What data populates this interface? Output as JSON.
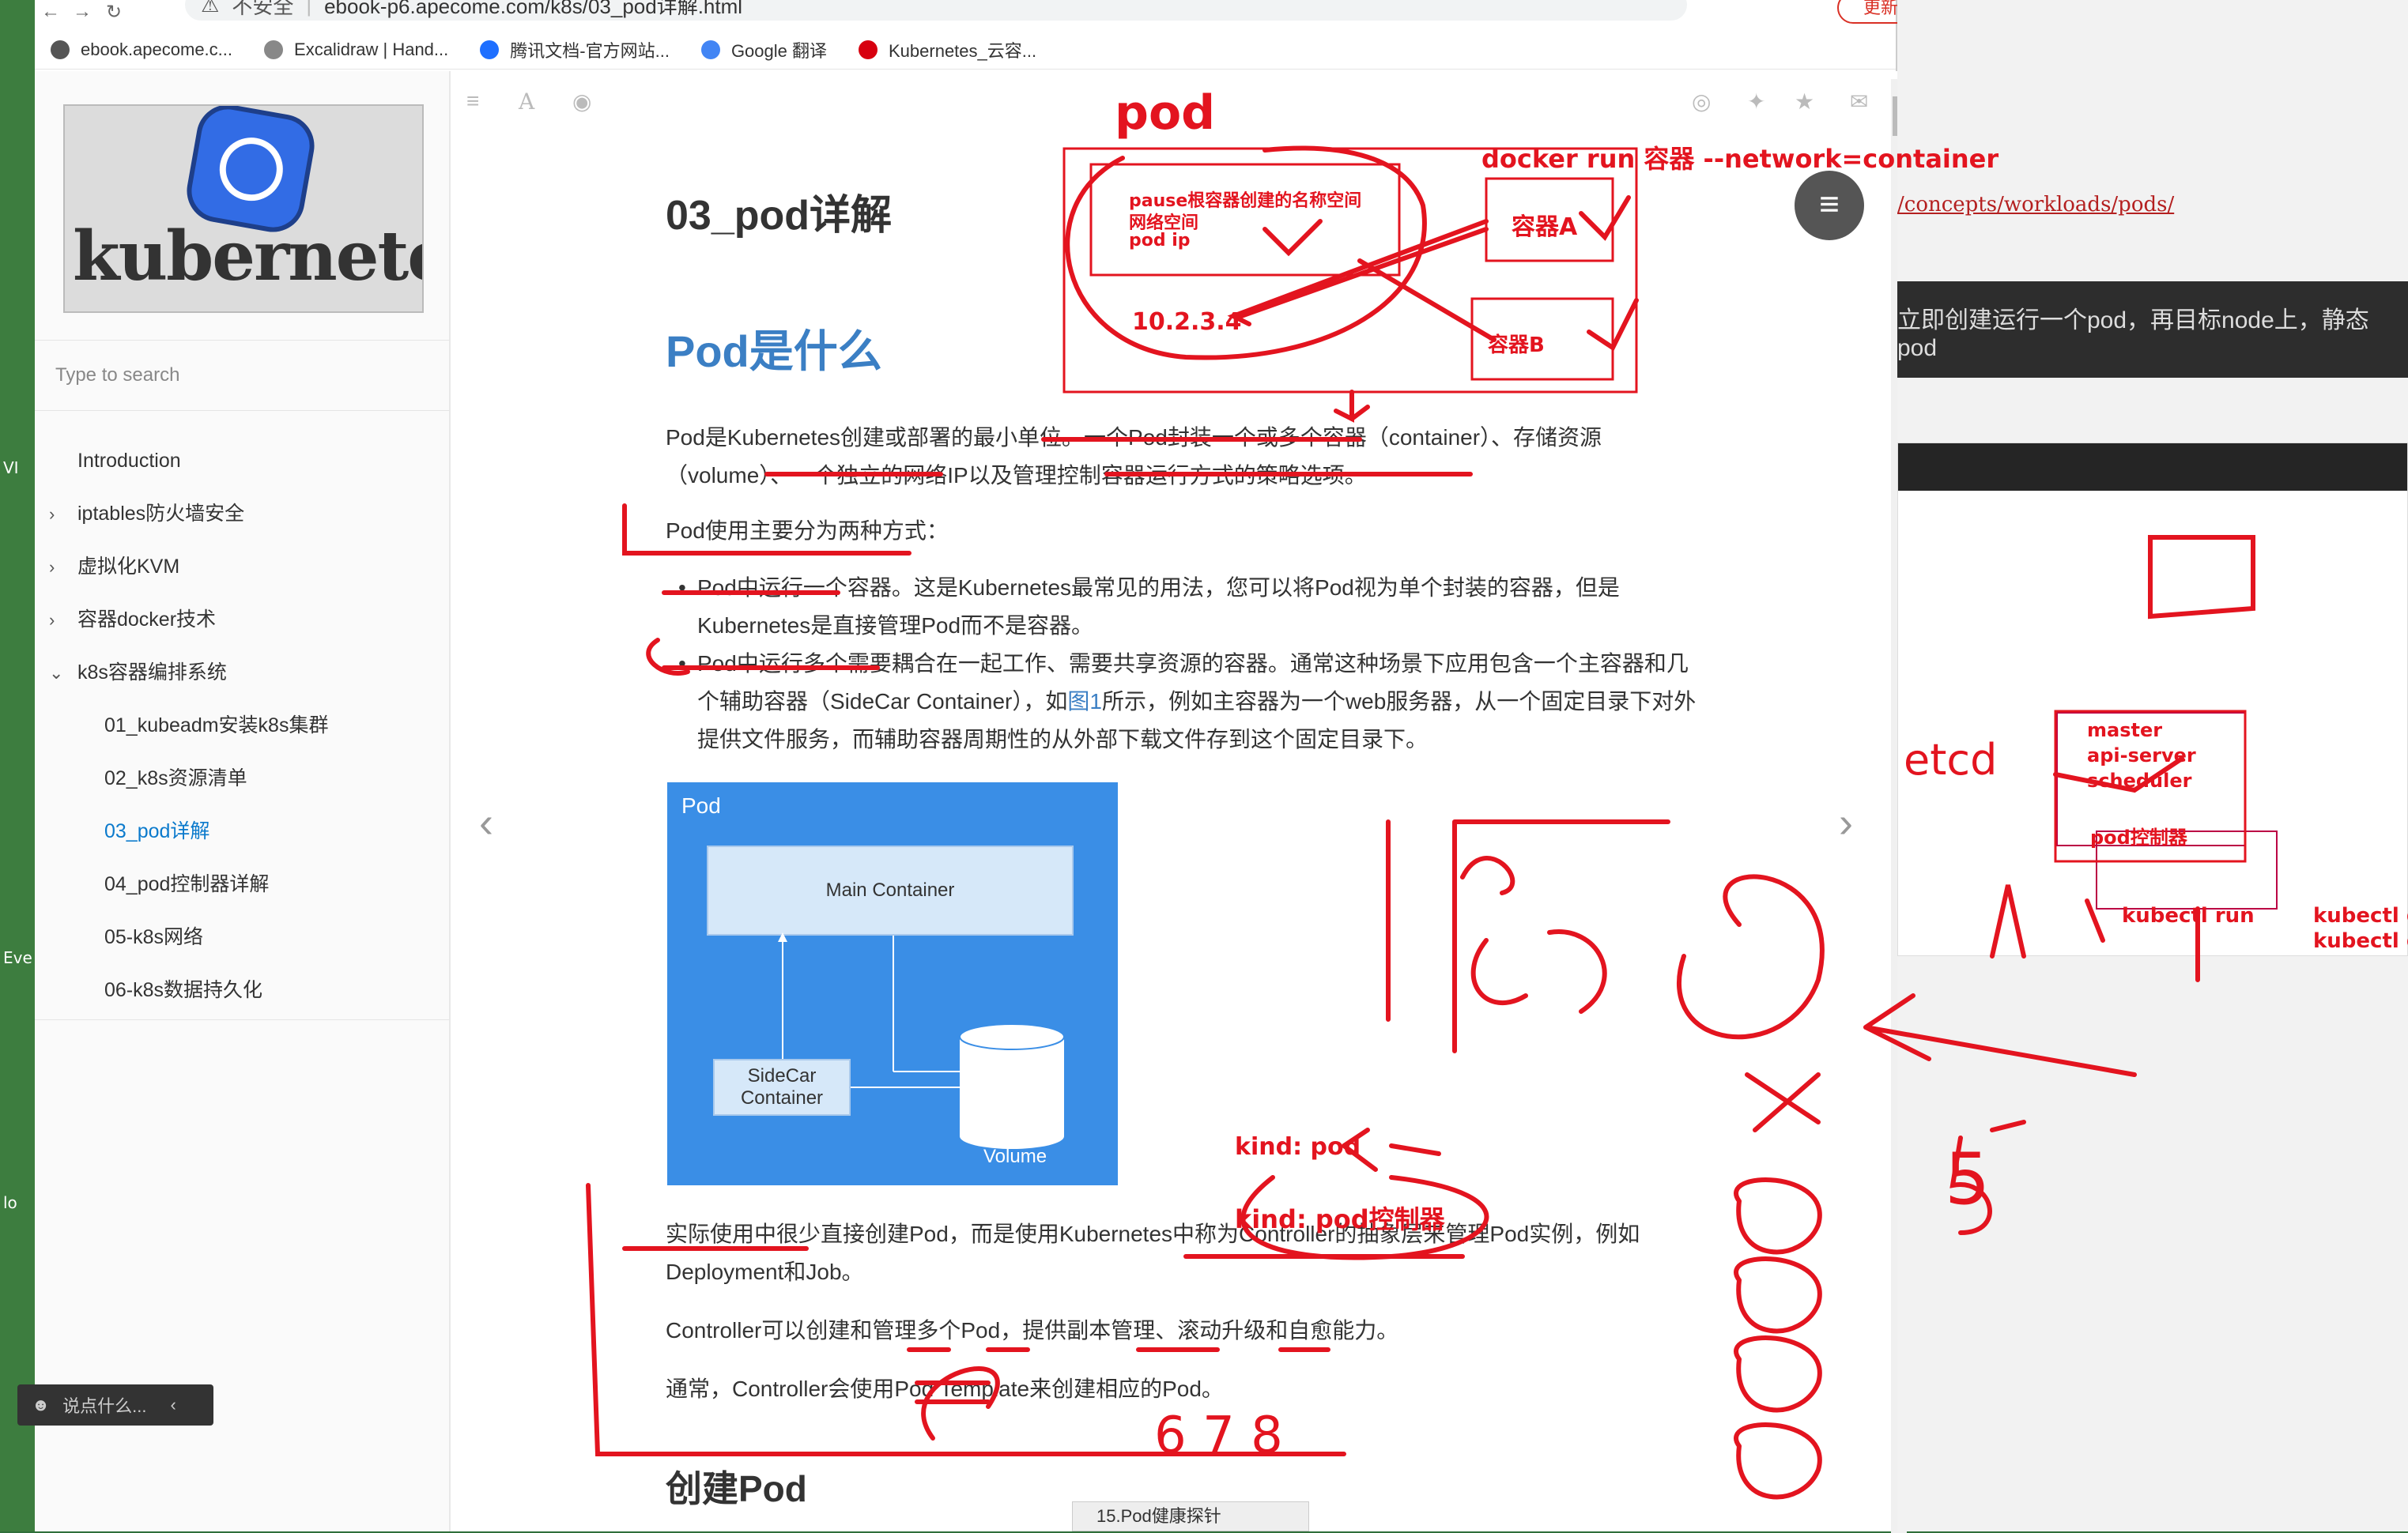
{
  "browser": {
    "insecure_label": "不安全",
    "url": "ebook-p6.apecome.com/k8s/03_pod详解.html",
    "update_label": "更新",
    "bookmarks": [
      {
        "label": "ebook.apecome.c...",
        "color": "#555"
      },
      {
        "label": "Excalidraw | Hand...",
        "color": "#888"
      },
      {
        "label": "腾讯文档-官方网站...",
        "color": "#1e6fff"
      },
      {
        "label": "Google 翻译",
        "color": "#4285f4"
      },
      {
        "label": "Kubernetes_云容...",
        "color": "#d7000f"
      }
    ]
  },
  "sidebar": {
    "logo_text": "kubernetes",
    "search_placeholder": "Type to search",
    "items": [
      {
        "label": "Introduction",
        "sub": false,
        "chevron": ""
      },
      {
        "label": "iptables防火墙安全",
        "sub": false,
        "chevron": "›"
      },
      {
        "label": "虚拟化KVM",
        "sub": false,
        "chevron": "›"
      },
      {
        "label": "容器docker技术",
        "sub": false,
        "chevron": "›"
      },
      {
        "label": "k8s容器编排系统",
        "sub": false,
        "chevron": "⌄"
      },
      {
        "label": "01_kubeadm安装k8s集群",
        "sub": true,
        "chevron": ""
      },
      {
        "label": "02_k8s资源清单",
        "sub": true,
        "chevron": ""
      },
      {
        "label": "03_pod详解",
        "sub": true,
        "chevron": "",
        "active": true
      },
      {
        "label": "04_pod控制器详解",
        "sub": true,
        "chevron": ""
      },
      {
        "label": "05-k8s网络",
        "sub": true,
        "chevron": ""
      },
      {
        "label": "06-k8s数据持久化",
        "sub": true,
        "chevron": ""
      }
    ],
    "comment_label": "说点什么..."
  },
  "article": {
    "title": "03_pod详解",
    "section_title": "Pod是什么",
    "para1": "Pod是Kubernetes创建或部署的最小单位。一个Pod封装一个或多个容器（container）、存储资源（volume）、一个独立的网络IP以及管理控制容器运行方式的策略选项。",
    "para2": "Pod使用主要分为两种方式：",
    "bullet1": "Pod中运行一个容器。这是Kubernetes最常见的用法，您可以将Pod视为单个封装的容器，但是Kubernetes是直接管理Pod而不是容器。",
    "bullet2_a": "Pod中运行多个需要耦合在一起工作、需要共享资源的容器。通常这种场景下应用包含一个主容器和几个辅助容器（SideCar Container），如",
    "bullet2_link": "图1",
    "bullet2_b": "所示，例如主容器为一个web服务器，从一个固定目录下对外提供文件服务，而辅助容器周期性的从外部下载文件存到这个固定目录下。",
    "diagram": {
      "title": "Pod",
      "main": "Main Container",
      "sidecar": "SideCar Container",
      "volume": "Volume"
    },
    "para3": "实际使用中很少直接创建Pod，而是使用Kubernetes中称为Controller的抽象层来管理Pod实例，例如Deployment和Job。",
    "para4": "Controller可以创建和管理多个Pod，提供副本管理、滚动升级和自愈能力。",
    "para5": "通常，Controller会使用Pod Template来创建相应的Pod。",
    "next_section": "创建Pod"
  },
  "annotations": {
    "pod": "pod",
    "docker_cmd": "docker run 容器 --network=container",
    "pause": "pause根容器创建的名称空间",
    "netns": "网络空间",
    "podip": "pod ip",
    "ip": "10.2.3.4",
    "container_a": "容器A",
    "container_b": "容器B",
    "kind_pod": "kind: pod",
    "kind_ctrl": "kind: pod控制器",
    "nums": "6 7 8",
    "five": "5"
  },
  "right_panel": {
    "link": "/concepts/workloads/pods/",
    "dark_text": "立即创建运行一个pod，再目标node上，静态pod",
    "master": "master",
    "apiserver": "api-server",
    "scheduler": "scheduler",
    "podctrl": "pod控制器",
    "etcd": "etcd",
    "kubectl_run": "kubectl run",
    "kubectl_de": "kubectl de",
    "kubectl_ge": "kubectl ge"
  },
  "taskbar": {
    "item": "15.Pod健康探针"
  },
  "colors": {
    "accent": "#3b7fc4",
    "ink": "#e3141f",
    "active": "#0b7acc"
  }
}
